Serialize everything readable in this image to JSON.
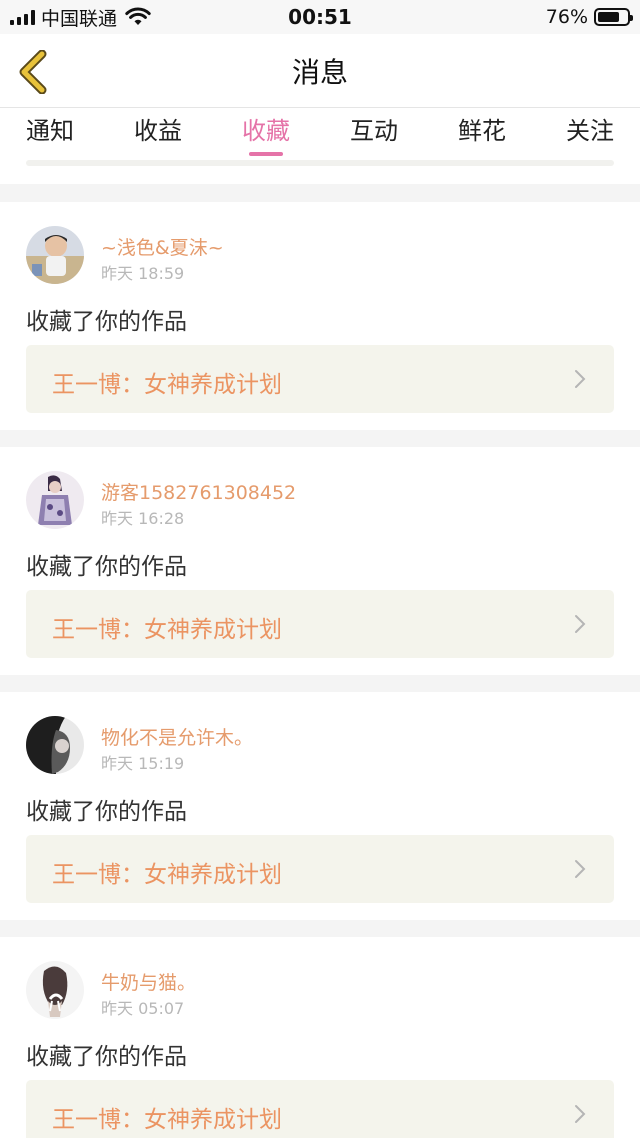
{
  "status_bar": {
    "carrier": "中国联通",
    "time": "00:51",
    "battery_text": "76%",
    "battery_level": 0.76
  },
  "nav": {
    "title": "消息"
  },
  "tabs": [
    {
      "label": "通知",
      "active": false
    },
    {
      "label": "收益",
      "active": false
    },
    {
      "label": "收藏",
      "active": true
    },
    {
      "label": "互动",
      "active": false
    },
    {
      "label": "鲜花",
      "active": false
    },
    {
      "label": "关注",
      "active": false
    }
  ],
  "messages": [
    {
      "user": "~浅色&夏沫~",
      "time": "昨天 18:59",
      "action": "收藏了你的作品",
      "work": "王一博：女神养成计划"
    },
    {
      "user": "游客1582761308452",
      "time": "昨天 16:28",
      "action": "收藏了你的作品",
      "work": "王一博：女神养成计划"
    },
    {
      "user": "物化不是允许木。",
      "time": "昨天 15:19",
      "action": "收藏了你的作品",
      "work": "王一博：女神养成计划"
    },
    {
      "user": "牛奶与猫。",
      "time": "昨天 05:07",
      "action": "收藏了你的作品",
      "work": "王一博：女神养成计划"
    }
  ],
  "colors": {
    "accent": "#e573a8",
    "username": "#e59b6c",
    "work_title": "#eb9462",
    "back_arrow": "#e8c23a"
  }
}
